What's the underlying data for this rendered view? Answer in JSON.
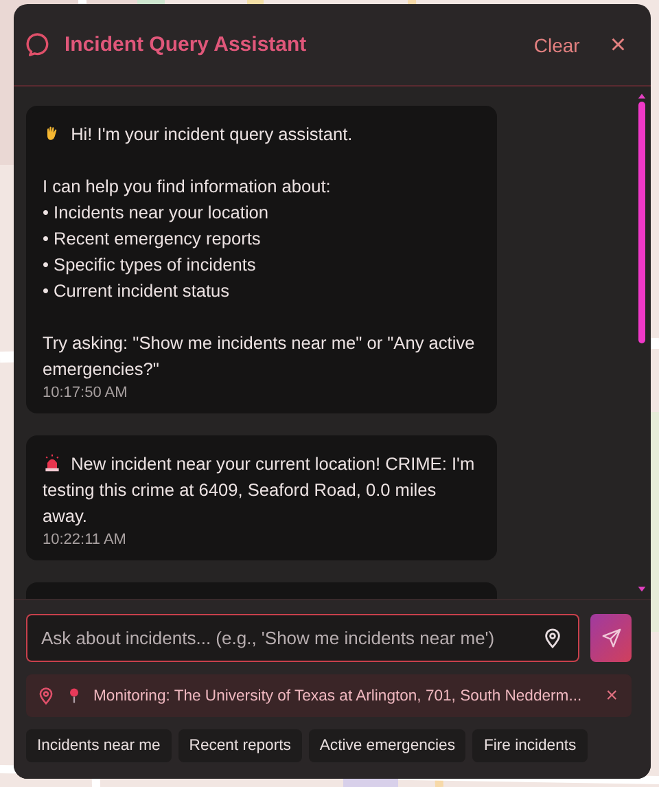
{
  "header": {
    "title": "Incident Query Assistant",
    "clear_label": "Clear",
    "close_label": "×"
  },
  "messages": [
    {
      "kind": "greeting",
      "text": "Hi! I'm your incident query assistant.\n\nI can help you find information about:\n• Incidents near your location\n• Recent emergency reports\n• Specific types of incidents\n• Current incident status\n\nTry asking: \"Show me incidents near me\" or \"Any active emergencies?\"",
      "time": "10:17:50 AM"
    },
    {
      "kind": "alert",
      "text": "New incident near your current location! CRIME: I'm testing this crime at 6409, Seaford Road, 0.0 miles away.",
      "time": "10:22:11 AM"
    },
    {
      "kind": "partial"
    }
  ],
  "input": {
    "placeholder": "Ask about incidents... (e.g., 'Show me incidents near me')"
  },
  "monitoring": {
    "text": "Monitoring: The University of Texas at Arlington, 701, South Nedderm...",
    "close_label": "×"
  },
  "suggestions": [
    "Incidents near me",
    "Recent reports",
    "Active emergencies",
    "Fire incidents"
  ]
}
